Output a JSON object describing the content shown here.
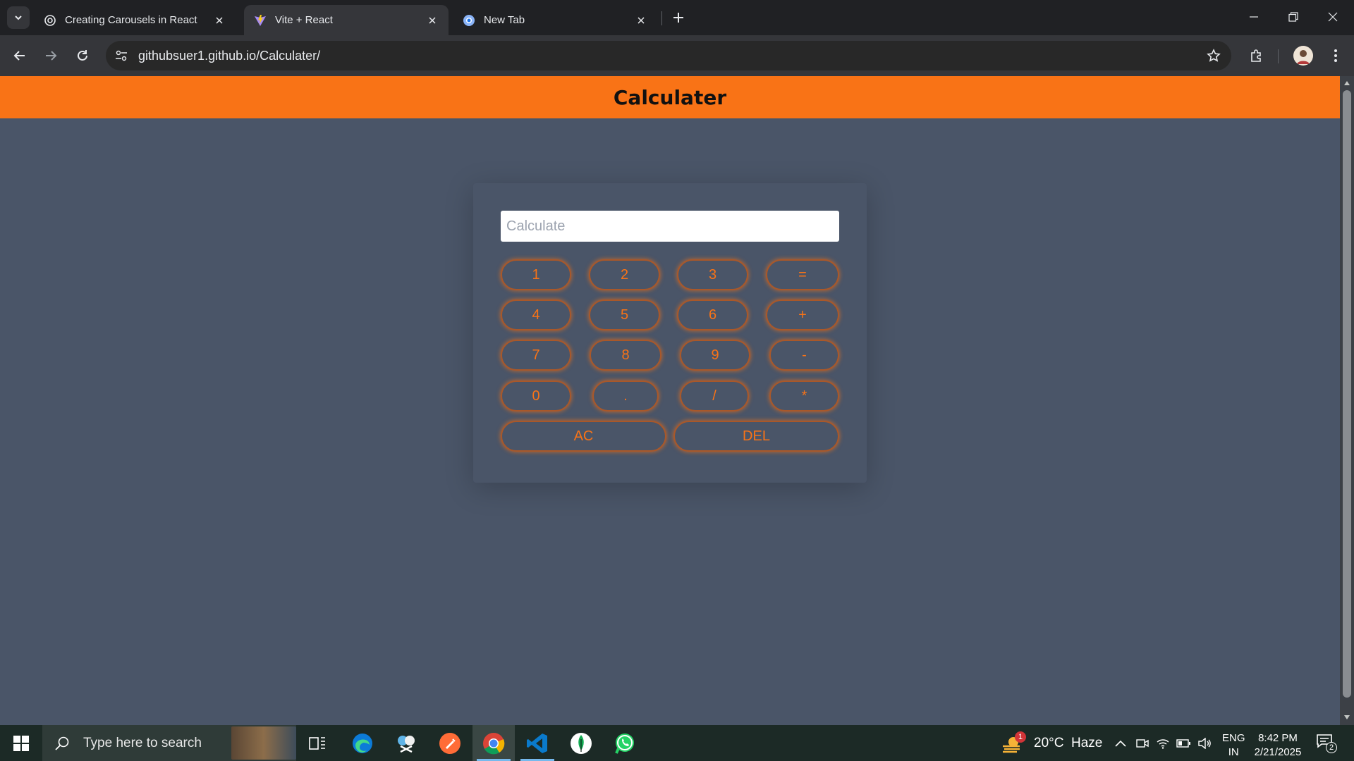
{
  "browser": {
    "tabs": [
      {
        "title": "Creating Carousels in React",
        "active": false
      },
      {
        "title": "Vite + React",
        "active": true
      },
      {
        "title": "New Tab",
        "active": false
      }
    ],
    "url": "githubsuer1.github.io/Calculater/"
  },
  "app": {
    "title": "Calculater",
    "accent_color": "#f97316",
    "background_color": "#4a5568",
    "input_placeholder": "Calculate",
    "keys": [
      "1",
      "2",
      "3",
      "=",
      "4",
      "5",
      "6",
      "+",
      "7",
      "8",
      "9",
      "-",
      "0",
      ".",
      "/",
      "*",
      "AC",
      "DEL"
    ]
  },
  "taskbar": {
    "search_placeholder": "Type here to search",
    "weather": "20°C  Haze",
    "weather_badge": "1",
    "language": "ENG",
    "region": "IN",
    "time": "8:42 PM",
    "date": "2/21/2025",
    "notification_count": "2"
  }
}
